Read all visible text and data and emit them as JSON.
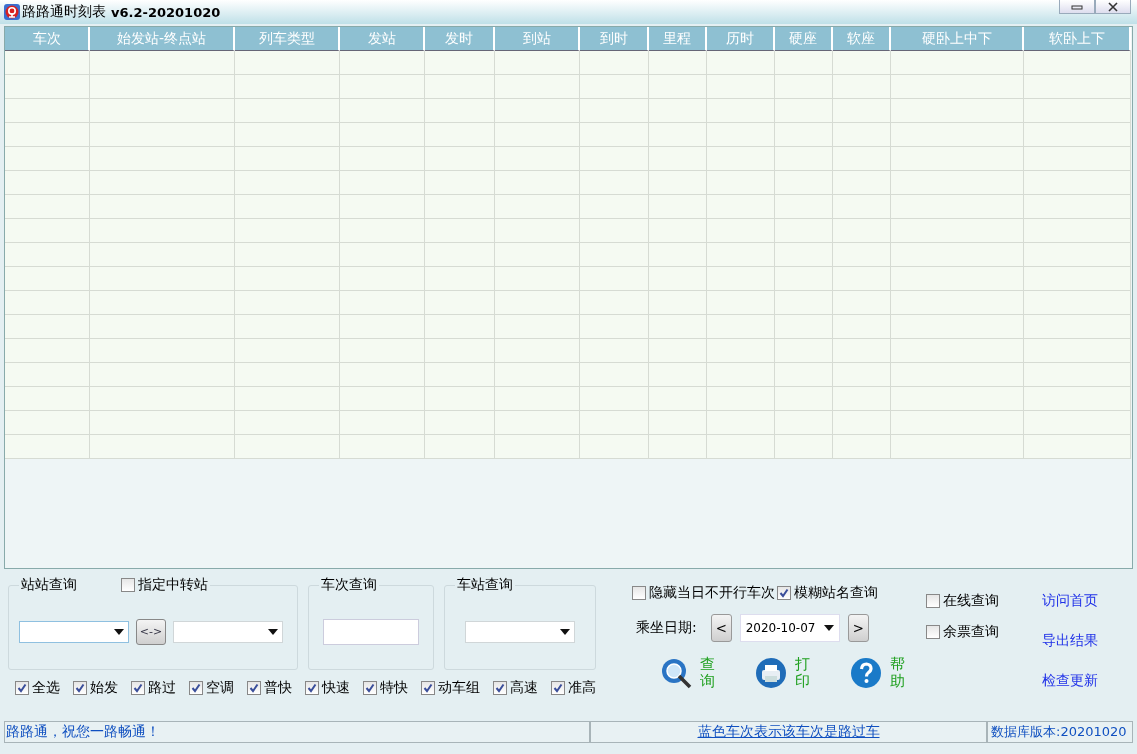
{
  "window": {
    "title": "路路通时刻表",
    "version": "v6.2-20201020"
  },
  "table": {
    "columns": [
      "车次",
      "始发站-终点站",
      "列车类型",
      "发站",
      "发时",
      "到站",
      "到时",
      "里程",
      "历时",
      "硬座",
      "软座",
      "硬卧上中下",
      "软卧上下"
    ]
  },
  "station_query": {
    "title": "站站查询",
    "transfer": {
      "label": "指定中转站",
      "checked": false
    },
    "swap_button": "<->"
  },
  "train_query": {
    "title": "车次查询"
  },
  "station_lookup": {
    "title": "车站查询"
  },
  "filters": [
    {
      "label": "全选",
      "checked": true
    },
    {
      "label": "始发",
      "checked": true
    },
    {
      "label": "路过",
      "checked": true
    },
    {
      "label": "空调",
      "checked": true
    },
    {
      "label": "普快",
      "checked": true
    },
    {
      "label": "快速",
      "checked": true
    },
    {
      "label": "特快",
      "checked": true
    },
    {
      "label": "动车组",
      "checked": true
    },
    {
      "label": "高速",
      "checked": true
    },
    {
      "label": "准高",
      "checked": true
    }
  ],
  "options": [
    {
      "label": "隐藏当日不开行车次",
      "checked": false
    },
    {
      "label": "模糊站名查询",
      "checked": true
    }
  ],
  "date": {
    "label": "乘坐日期:",
    "prev": "<",
    "value": "2020-10-07",
    "next": ">"
  },
  "actions": [
    {
      "kind": "search",
      "label": "查询"
    },
    {
      "kind": "print",
      "label": "打印"
    },
    {
      "kind": "help",
      "label": "帮助"
    }
  ],
  "online": [
    {
      "label": "在线查询",
      "checked": false
    },
    {
      "label": "余票查询",
      "checked": false
    }
  ],
  "links": [
    "访问首页",
    "导出结果",
    "检查更新"
  ],
  "status_bar": {
    "message": "路路通，祝您一路畅通！",
    "hint": "蓝色车次表示该车次是路过车",
    "db_version": "数据库版本:20201020"
  }
}
